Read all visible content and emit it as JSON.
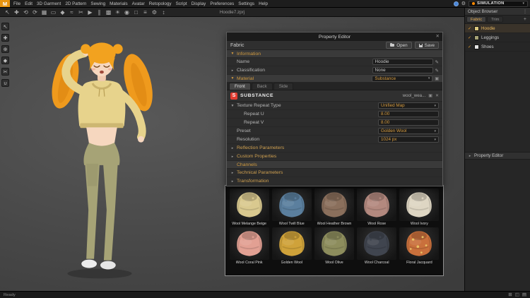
{
  "icons": {
    "check": "✓",
    "dropdown": "▾",
    "collapsed": "▸",
    "expanded": "▼",
    "edit": "✎",
    "close": "✕",
    "add": "+",
    "menu_dots": "⋮",
    "gear": "⚙",
    "substance_logo": "S",
    "link": "▣",
    "clear": "✕"
  },
  "app": {
    "logo": "M",
    "window_title": "Hoodie7.zprj",
    "mode": "SIMULATION",
    "status_left": "Ready"
  },
  "menubar": {
    "items": [
      "File",
      "Edit",
      "3D Garment",
      "2D Pattern",
      "Sewing",
      "Materials",
      "Avatar",
      "Retopology",
      "Script",
      "Display",
      "Preferences",
      "Settings",
      "Help"
    ]
  },
  "toolbar": {
    "icons": [
      {
        "name": "select-icon",
        "glyph": "↖"
      },
      {
        "name": "move-icon",
        "glyph": "✚"
      },
      {
        "name": "rotate-view-icon",
        "glyph": "⟲"
      },
      {
        "name": "reset-view-icon",
        "glyph": "⟳"
      },
      {
        "name": "grid-icon",
        "glyph": "▦"
      },
      {
        "name": "pattern-icon",
        "glyph": "▭"
      },
      {
        "name": "pin-icon",
        "glyph": "◆"
      },
      {
        "name": "sewing-icon",
        "glyph": "≈"
      },
      {
        "name": "scissors-icon",
        "glyph": "✂"
      },
      {
        "name": "play-simulation-icon",
        "glyph": "▶"
      },
      {
        "name": "pause-simulation-icon",
        "glyph": "∥"
      },
      {
        "name": "texture-icon",
        "glyph": "▩"
      },
      {
        "name": "light-icon",
        "glyph": "☀"
      },
      {
        "name": "camera-icon",
        "glyph": "◉"
      },
      {
        "name": "snapshot-icon",
        "glyph": "□"
      },
      {
        "name": "measure-icon",
        "glyph": "≡"
      },
      {
        "name": "settings-icon",
        "glyph": "⚙"
      },
      {
        "name": "fullscreen-icon",
        "glyph": "↕"
      }
    ]
  },
  "side_tools": {
    "icons": [
      {
        "name": "select-tool-icon",
        "glyph": "↖"
      },
      {
        "name": "pan-tool-icon",
        "glyph": "✚"
      },
      {
        "name": "zoom-tool-icon",
        "glyph": "⊕"
      },
      {
        "name": "pin-tool-icon",
        "glyph": "◆"
      },
      {
        "name": "scissors-tool-icon",
        "glyph": "✂"
      },
      {
        "name": "magnet-tool-icon",
        "glyph": "∪"
      }
    ]
  },
  "property_editor": {
    "title": "Property Editor",
    "fabric": {
      "label": "Fabric",
      "open": "Open",
      "save": "Save"
    },
    "information": {
      "header": "Information",
      "name_label": "Name",
      "name_value": "Hoodie",
      "classification_label": "Classification",
      "classification_value": "None"
    },
    "material": {
      "header": "Material",
      "type_value": "Substance",
      "tabs": [
        {
          "label": "Front",
          "active": true
        },
        {
          "label": "Back",
          "active": false
        },
        {
          "label": "Side",
          "active": false
        }
      ],
      "brand": "SUBSTANCE",
      "file": "wool_wea...",
      "texture_repeat_label": "Texture Repeat Type",
      "texture_repeat_value": "Unified Map",
      "repeat_u_label": "Repeat U",
      "repeat_u_value": "8.00",
      "repeat_v_label": "Repeat V",
      "repeat_v_value": "8.00",
      "preset_label": "Preset",
      "preset_value": "Golden Wool",
      "resolution_label": "Resolution",
      "resolution_value": "1024 px",
      "collapsed": [
        {
          "label": "Reflection Parameters"
        },
        {
          "label": "Custom Properties"
        }
      ]
    },
    "channels": {
      "header": "Channels",
      "collapsed": [
        {
          "label": "Technical Parameters"
        },
        {
          "label": "Transformation"
        }
      ]
    }
  },
  "materials_panel": {
    "items": [
      {
        "name": "Wool Melange Beige",
        "color": "#d9c98f"
      },
      {
        "name": "Wool Twill Blue",
        "color": "#5b7f9e"
      },
      {
        "name": "Wool Heather Brown",
        "color": "#8a6f5c"
      },
      {
        "name": "Wool Rose",
        "color": "#b3897f"
      },
      {
        "name": "Wool Ivory",
        "color": "#ded6c3"
      },
      {
        "name": "Wool Coral Pink",
        "color": "#e2a093"
      },
      {
        "name": "Golden Wool",
        "color": "#cfa23a"
      },
      {
        "name": "Wool Olive",
        "color": "#8d8d5d"
      },
      {
        "name": "Wool Charcoal",
        "color": "#40454f"
      },
      {
        "name": "Floral Jacquard",
        "color": "#c9703c",
        "accent": "#ecc968"
      }
    ]
  },
  "right_panel": {
    "object_browser": {
      "title": "Object Browser",
      "tabs": [
        {
          "label": "Fabric",
          "active": true
        },
        {
          "label": "Trim",
          "active": false
        }
      ],
      "items": [
        {
          "name": "Hoodie",
          "color": "#dcc87e",
          "checked": true,
          "selected": true
        },
        {
          "name": "Leggings",
          "color": "#a6a376",
          "checked": true,
          "selected": false
        },
        {
          "name": "Shoes",
          "color": "#e3e3e3",
          "checked": true,
          "selected": false
        }
      ]
    },
    "property_editor_label": "Property Editor"
  },
  "statusbar": {
    "icons": [
      {
        "name": "grid-view-icon",
        "glyph": "⊞"
      },
      {
        "name": "split-view-icon",
        "glyph": "◫"
      },
      {
        "name": "log-panel-icon",
        "glyph": "▤"
      }
    ]
  }
}
